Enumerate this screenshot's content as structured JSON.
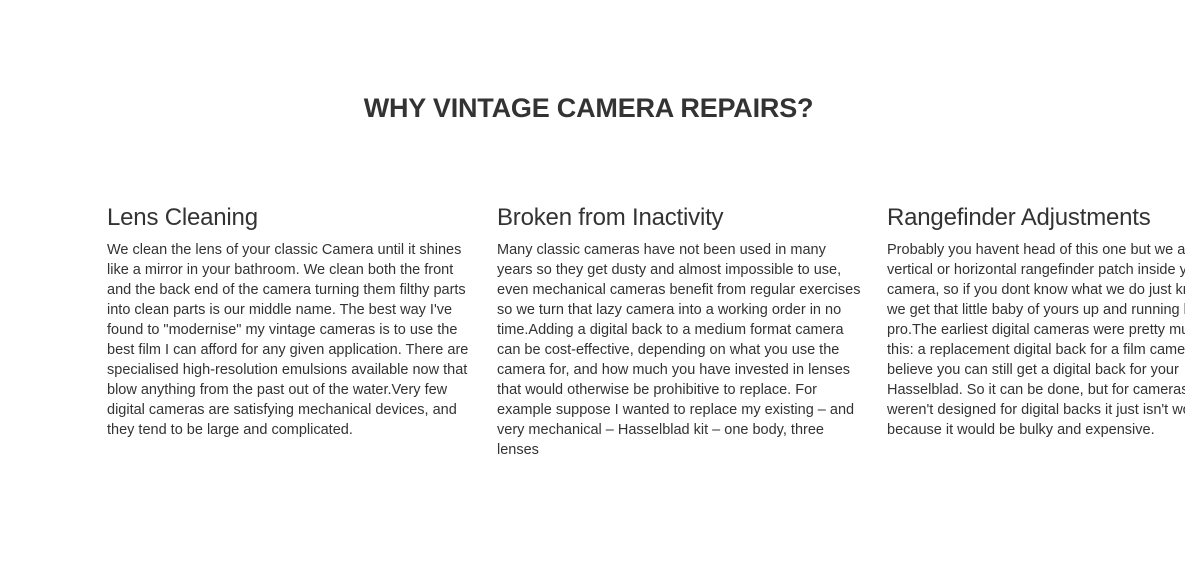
{
  "section": {
    "title": "WHY VINTAGE CAMERA REPAIRS?"
  },
  "features": [
    {
      "title": "Lens Cleaning",
      "text": "We clean the lens of your classic Camera until it shines like a mirror in your bathroom. We clean both the front and the back end of the camera turning them filthy parts into clean parts is our middle name. The best way I've found to \"modernise\" my vintage cameras is to use the best film I can afford for any given application. There are specialised high-resolution emulsions available now that blow anything from the past out of the water.Very few digital cameras are satisfying mechanical devices, and they tend to be large and complicated."
    },
    {
      "title": "Broken from Inactivity",
      "text": "Many classic cameras have not been used in many years so they get dusty and almost impossible to use, even mechanical cameras benefit from regular exercises so we turn that lazy camera into a working order in no time.Adding a digital back to a medium format camera can be cost-effective, depending on what you use the camera for, and how much you have invested in lenses that would otherwise be prohibitive to replace. For example suppose I wanted to replace my existing – and very mechanical – Hasselblad kit – one body, three lenses"
    },
    {
      "title": "Rangefinder Adjustments",
      "text": "Probably you havent head of this one but we adjust the vertical or horizontal rangefinder patch inside your camera, so if you dont know what we do just know that we get that little baby of yours up and running like a pro.The earliest digital cameras were pretty much just this: a replacement digital back for a film camera. I believe you can still get a digital back for your Hasselblad. So it can be done, but for cameras that weren't designed for digital backs it just isn't worth it because it would be bulky and expensive."
    }
  ]
}
